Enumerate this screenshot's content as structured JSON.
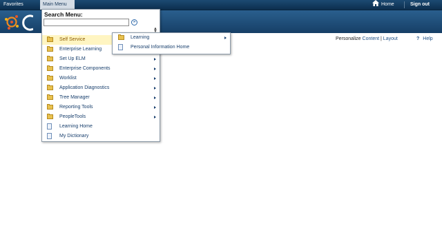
{
  "topnav": {
    "favorites": "Favorites",
    "main_menu": "Main Menu",
    "home": "Home",
    "sign_out": "Sign out"
  },
  "content_header": {
    "personalize": "Personalize",
    "content": "Content",
    "separator": "|",
    "layout": "Layout",
    "help_icon": "?",
    "help": "Help"
  },
  "menu": {
    "search_label": "Search Menu:",
    "search_value": "",
    "search_go_glyph": "»",
    "items": [
      {
        "label": "Self Service",
        "icon": "folder-icon",
        "has_submenu": true,
        "active": true
      },
      {
        "label": "Enterprise Learning",
        "icon": "folder-icon",
        "has_submenu": true
      },
      {
        "label": "Set Up ELM",
        "icon": "folder-icon",
        "has_submenu": true
      },
      {
        "label": "Enterprise Components",
        "icon": "folder-icon",
        "has_submenu": true
      },
      {
        "label": "Worklist",
        "icon": "folder-icon",
        "has_submenu": true
      },
      {
        "label": "Application Diagnostics",
        "icon": "folder-icon",
        "has_submenu": true
      },
      {
        "label": "Tree Manager",
        "icon": "folder-icon",
        "has_submenu": true
      },
      {
        "label": "Reporting Tools",
        "icon": "folder-icon",
        "has_submenu": true
      },
      {
        "label": "PeopleTools",
        "icon": "folder-icon",
        "has_submenu": true
      },
      {
        "label": "Learning Home",
        "icon": "page-icon",
        "has_submenu": false
      },
      {
        "label": "My Dictionary",
        "icon": "page-icon",
        "has_submenu": false
      }
    ]
  },
  "submenu": {
    "items": [
      {
        "label": "Learning",
        "icon": "folder-icon",
        "has_submenu": true
      },
      {
        "label": "Personal Information Home",
        "icon": "page-icon",
        "has_submenu": false
      }
    ]
  },
  "colors": {
    "topbar": "#0c2e4e",
    "banner": "#1f4f7c",
    "link": "#173e6c",
    "active_item_bg": "#fff5c2"
  }
}
